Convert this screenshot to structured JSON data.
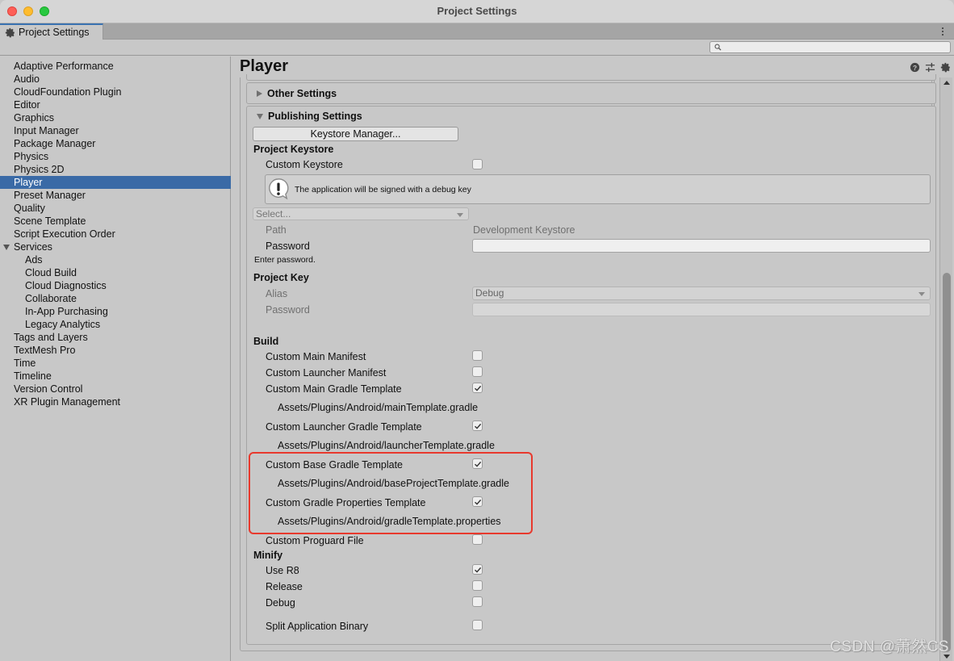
{
  "window": {
    "title": "Project Settings"
  },
  "tab": {
    "label": "Project Settings",
    "icon": "gear-icon"
  },
  "search": {
    "placeholder": "",
    "value": ""
  },
  "sidebar": {
    "selected": "Player",
    "items": [
      {
        "label": "Adaptive Performance",
        "level": 0
      },
      {
        "label": "Audio",
        "level": 0
      },
      {
        "label": "CloudFoundation Plugin",
        "level": 0
      },
      {
        "label": "Editor",
        "level": 0
      },
      {
        "label": "Graphics",
        "level": 0
      },
      {
        "label": "Input Manager",
        "level": 0
      },
      {
        "label": "Package Manager",
        "level": 0
      },
      {
        "label": "Physics",
        "level": 0
      },
      {
        "label": "Physics 2D",
        "level": 0
      },
      {
        "label": "Player",
        "level": 0
      },
      {
        "label": "Preset Manager",
        "level": 0
      },
      {
        "label": "Quality",
        "level": 0
      },
      {
        "label": "Scene Template",
        "level": 0
      },
      {
        "label": "Script Execution Order",
        "level": 0
      },
      {
        "label": "Services",
        "level": 0,
        "expanded": true
      },
      {
        "label": "Ads",
        "level": 1
      },
      {
        "label": "Cloud Build",
        "level": 1
      },
      {
        "label": "Cloud Diagnostics",
        "level": 1
      },
      {
        "label": "Collaborate",
        "level": 1
      },
      {
        "label": "In-App Purchasing",
        "level": 1
      },
      {
        "label": "Legacy Analytics",
        "level": 1
      },
      {
        "label": "Tags and Layers",
        "level": 0
      },
      {
        "label": "TextMesh Pro",
        "level": 0
      },
      {
        "label": "Time",
        "level": 0
      },
      {
        "label": "Timeline",
        "level": 0
      },
      {
        "label": "Version Control",
        "level": 0
      },
      {
        "label": "XR Plugin Management",
        "level": 0
      }
    ]
  },
  "main": {
    "title": "Player",
    "header_icons": [
      "help-icon",
      "preset-sliders-icon",
      "gear-icon"
    ],
    "other_settings": {
      "label": "Other Settings",
      "expanded": false
    },
    "publishing": {
      "label": "Publishing Settings",
      "expanded": true,
      "keystore_manager_button": "Keystore Manager...",
      "project_keystore": {
        "heading": "Project Keystore",
        "custom_keystore_label": "Custom Keystore",
        "custom_keystore_checked": false,
        "help_message": "The application will be signed with a debug key",
        "select_placeholder": "Select...",
        "path_label": "Path",
        "path_value": "Development Keystore",
        "password_label": "Password",
        "password_value": "",
        "password_hint": "Enter password."
      },
      "project_key": {
        "heading": "Project Key",
        "alias_label": "Alias",
        "alias_value": "Debug",
        "password_label": "Password",
        "password_value": ""
      },
      "build": {
        "heading": "Build",
        "items": [
          {
            "label": "Custom Main Manifest",
            "checked": false
          },
          {
            "label": "Custom Launcher Manifest",
            "checked": false
          },
          {
            "label": "Custom Main Gradle Template",
            "checked": true,
            "path": "Assets/Plugins/Android/mainTemplate.gradle"
          },
          {
            "label": "Custom Launcher Gradle Template",
            "checked": true,
            "path": "Assets/Plugins/Android/launcherTemplate.gradle"
          },
          {
            "label": "Custom Base Gradle Template",
            "checked": true,
            "path": "Assets/Plugins/Android/baseProjectTemplate.gradle"
          },
          {
            "label": "Custom Gradle Properties Template",
            "checked": true,
            "path": "Assets/Plugins/Android/gradleTemplate.properties"
          },
          {
            "label": "Custom Proguard File",
            "checked": false
          }
        ]
      },
      "minify": {
        "heading": "Minify",
        "items": [
          {
            "label": "Use R8",
            "checked": true
          },
          {
            "label": "Release",
            "checked": false
          },
          {
            "label": "Debug",
            "checked": false
          }
        ]
      },
      "split_binary": {
        "label": "Split Application Binary",
        "checked": false
      }
    }
  },
  "annotation": {
    "color": "#e8392d"
  },
  "watermark": "CSDN @萧然CS"
}
